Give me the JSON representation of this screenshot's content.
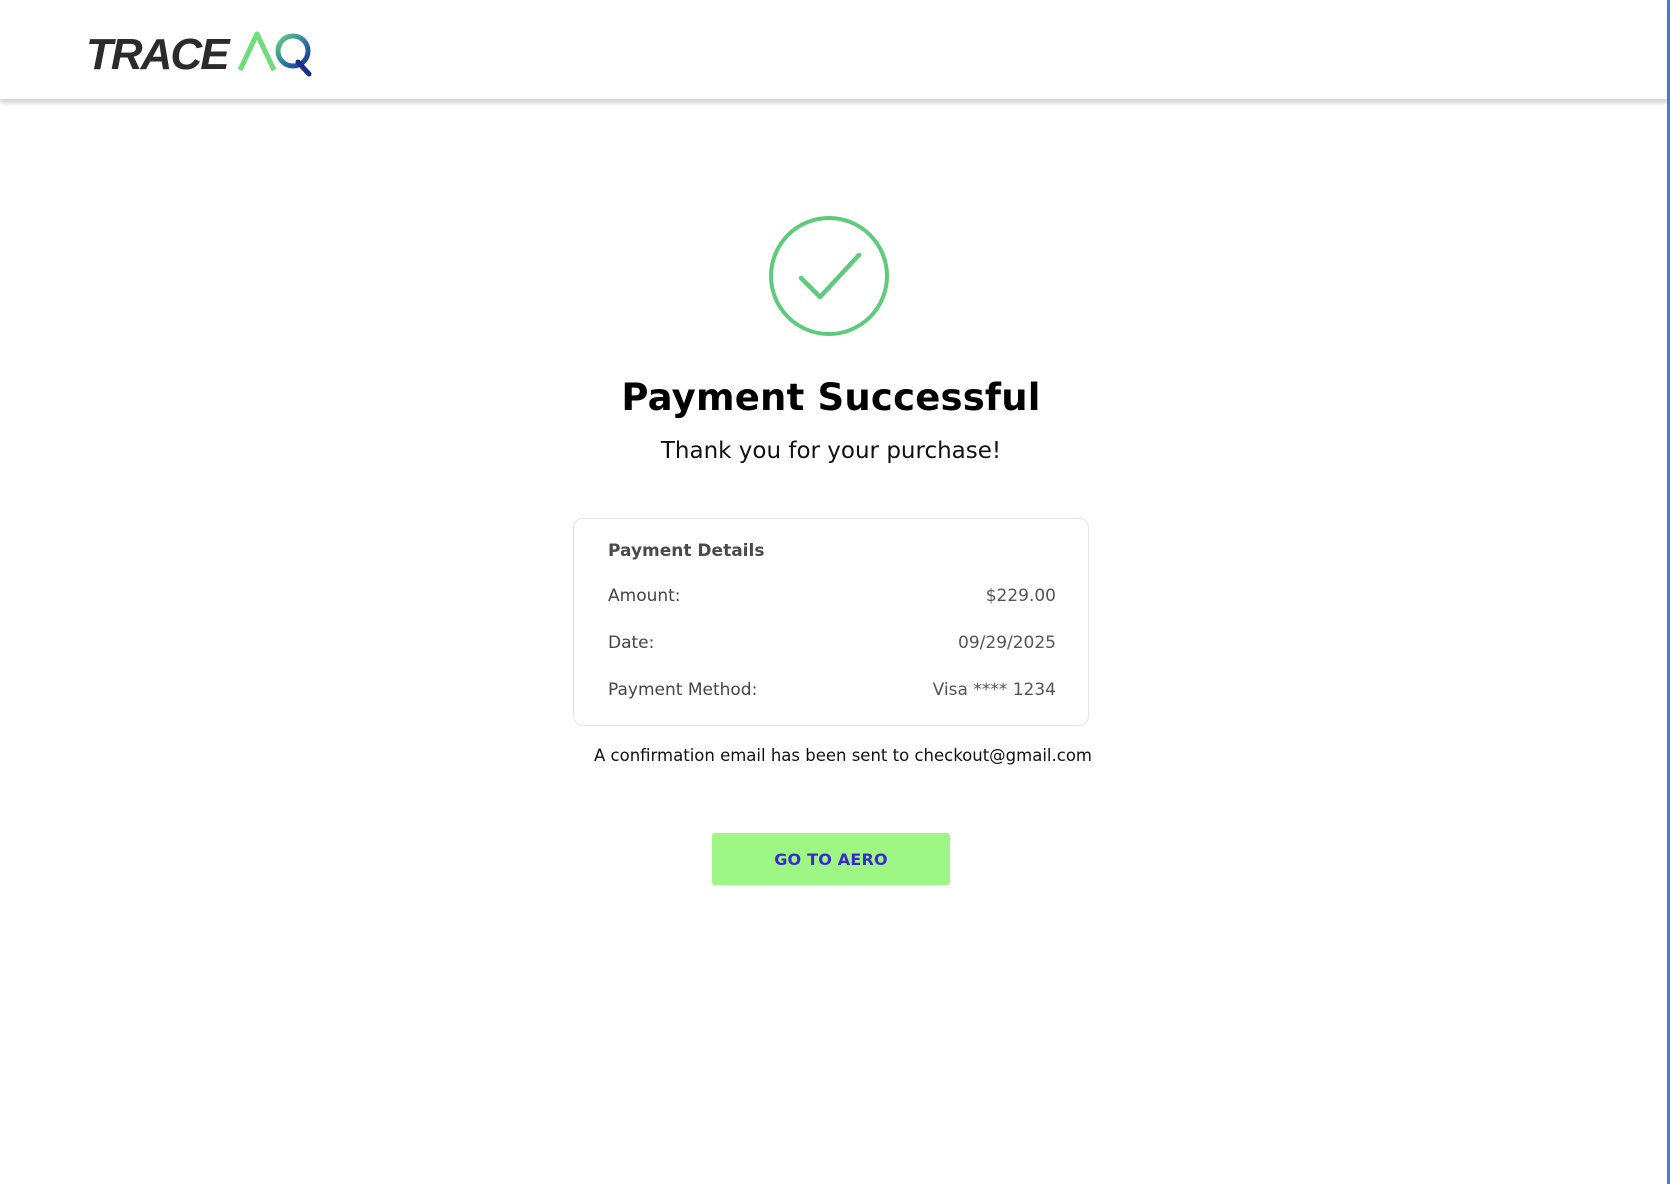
{
  "brand": {
    "logo_text": "TRACE",
    "logo_mark_text": "AQ",
    "logo_mark_colors": [
      "#6fdc7a",
      "#1b3a8c"
    ]
  },
  "status": {
    "icon": "check-circle-icon",
    "icon_color": "#5ecb7c",
    "title": "Payment Successful",
    "subtitle": "Thank you for your purchase!"
  },
  "details": {
    "heading": "Payment Details",
    "rows": [
      {
        "label": "Amount:",
        "value": "$229.00"
      },
      {
        "label": "Date:",
        "value": "09/29/2025"
      },
      {
        "label": "Payment Method:",
        "value": "Visa **** 1234"
      }
    ]
  },
  "confirmation_text": "A confirmation email has been sent to checkout@gmail.com",
  "cta": {
    "label": "GO TO AERO",
    "background": "#9ef784",
    "text_color": "#3a2bd1"
  }
}
